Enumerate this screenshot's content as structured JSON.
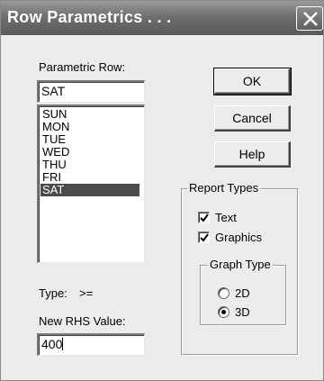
{
  "window": {
    "title": "Row Parametrics . . .",
    "close_label": "X"
  },
  "parametric_row": {
    "label": "Parametric Row:",
    "value": "SAT"
  },
  "row_list": {
    "items": [
      "SUN",
      "MON",
      "TUE",
      "WED",
      "THU",
      "FRI",
      "SAT"
    ],
    "selected": "SAT"
  },
  "type": {
    "label": "Type:",
    "value": ">="
  },
  "new_rhs": {
    "label": "New RHS Value:",
    "value": "400"
  },
  "buttons": {
    "ok": "OK",
    "cancel": "Cancel",
    "help": "Help"
  },
  "report_types": {
    "title": "Report Types",
    "text_label": "Text",
    "text_checked": true,
    "graphics_label": "Graphics",
    "graphics_checked": true
  },
  "graph_type": {
    "title": "Graph Type",
    "option_2d": "2D",
    "option_3d": "3D",
    "selected": "3D"
  },
  "colors": {
    "dialog_bg": "#ececec",
    "selection_bg": "#4b4b4b",
    "titlebar": "#6f6f6f"
  }
}
